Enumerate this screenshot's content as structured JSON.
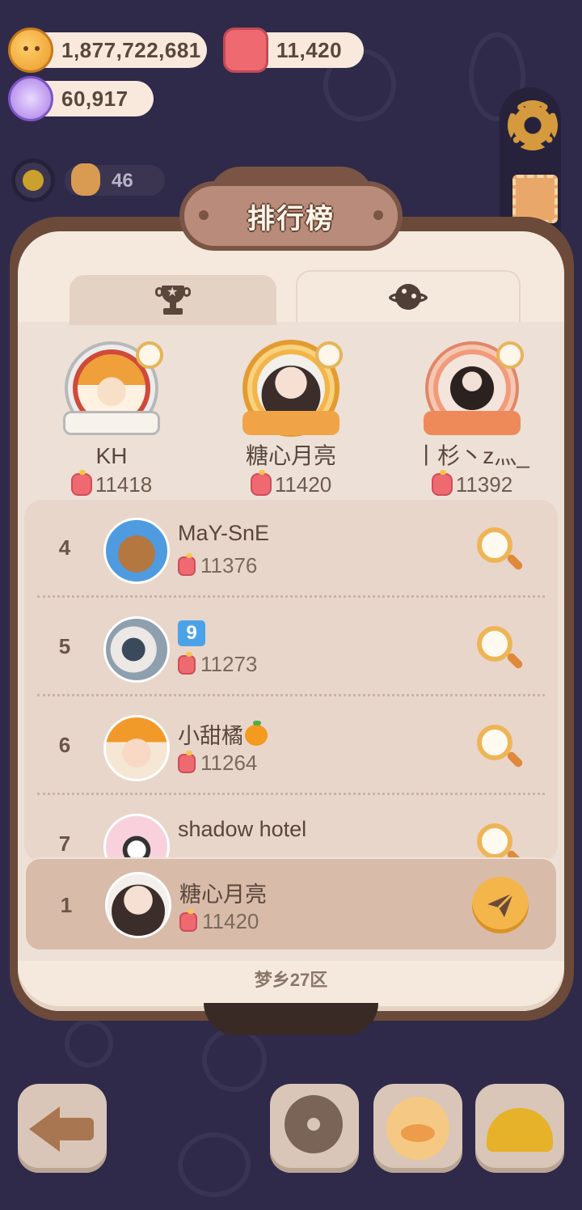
{
  "currencies": {
    "coins": {
      "icon": "cookie-coin-icon",
      "value": "1,877,722,681"
    },
    "jelly": {
      "icon": "jelly-icon",
      "value": "11,420"
    },
    "candy": {
      "icon": "candy-gem-icon",
      "value": "60,917"
    }
  },
  "status": {
    "level_count": "46"
  },
  "leaderboard": {
    "title": "排行榜",
    "tabs": [
      {
        "icon": "trophy-icon",
        "active": false
      },
      {
        "icon": "planet-icon",
        "active": true
      }
    ],
    "podium": [
      {
        "place": 2,
        "name": "KH",
        "score": "11418"
      },
      {
        "place": 1,
        "name": "糖心月亮",
        "score": "11420"
      },
      {
        "place": 3,
        "name": "丨杉丶z灬_",
        "score": "11392"
      }
    ],
    "rows": [
      {
        "rank": "4",
        "name": "MaY-SnE",
        "score": "11376"
      },
      {
        "rank": "5",
        "name": "9",
        "score": "11273"
      },
      {
        "rank": "6",
        "name": "小甜橘",
        "score": "11264"
      },
      {
        "rank": "7",
        "name": "shadow hotel",
        "score": ""
      }
    ],
    "me": {
      "rank": "1",
      "name": "糖心月亮",
      "score": "11420"
    },
    "server": "梦乡27区"
  },
  "bottom_bar": [
    "back-arrow-icon",
    "film-reel-icon",
    "duck-avatar-icon",
    "hard-hat-icon"
  ],
  "colors": {
    "background": "#2f2a4a",
    "board_frame": "#6b4a3a",
    "panel": "#f5e9de",
    "accent": "#f4b64a",
    "jelly": "#ee6a70"
  }
}
